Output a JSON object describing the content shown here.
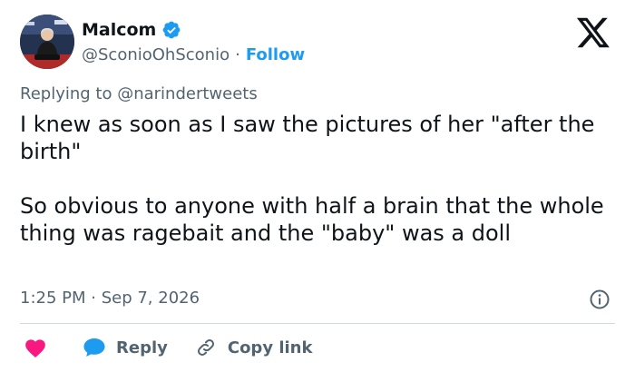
{
  "author": {
    "name": "Malcom",
    "handle": "@SconioOhSconio",
    "separator": "·",
    "follow_label": "Follow",
    "verified": true
  },
  "reply_context": {
    "prefix": "Replying to",
    "mention": "@narindertweets"
  },
  "tweet": {
    "text": "I knew as soon as I saw the pictures of her \"after the birth\"\n\nSo obvious to anyone with half a brain that the whole thing was ragebait and the \"baby\" was a doll"
  },
  "meta": {
    "timestamp": "1:25 PM · Sep 7, 2026"
  },
  "actions": {
    "reply_label": "Reply",
    "copy_link_label": "Copy link"
  },
  "icons": {
    "brand": "x-logo-icon",
    "verified": "verified-badge-icon",
    "info": "info-icon",
    "like": "heart-icon",
    "reply": "reply-bubble-icon",
    "copy_link": "link-icon"
  },
  "colors": {
    "accent": "#1d9bf0",
    "text": "#0f1419",
    "secondary": "#536471",
    "like": "#f91880",
    "divider": "#cfd9de"
  }
}
